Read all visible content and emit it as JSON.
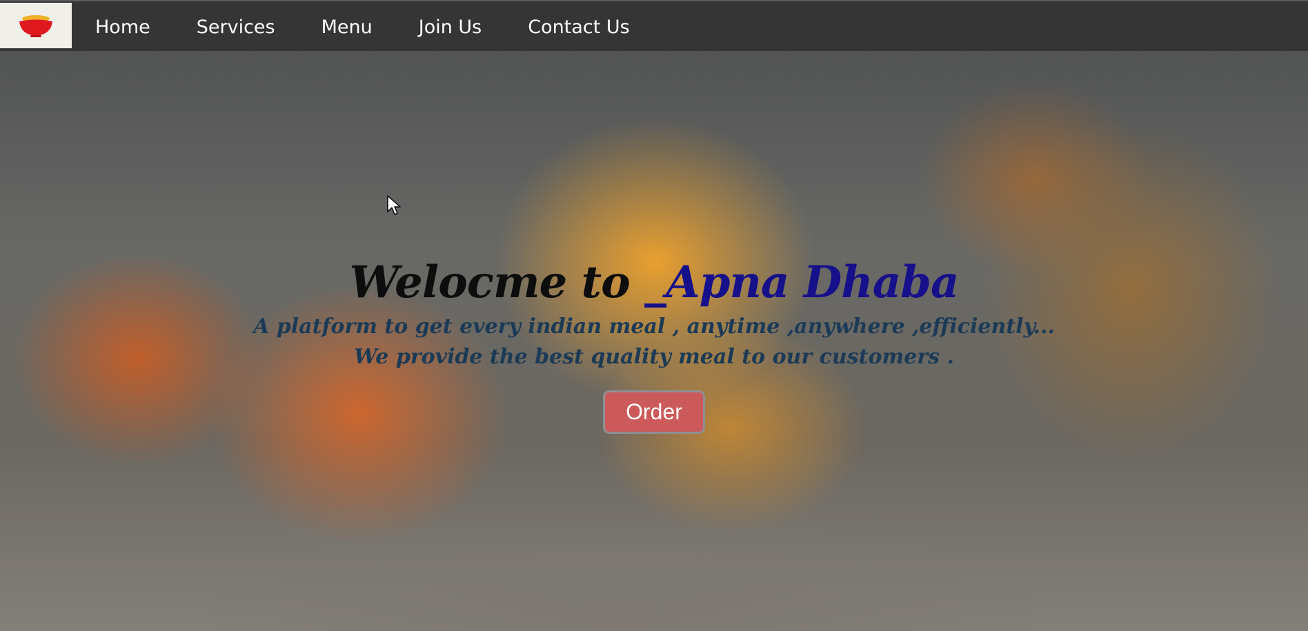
{
  "navbar": {
    "logo_icon": "bowl-icon",
    "items": [
      {
        "label": "Home"
      },
      {
        "label": "Services"
      },
      {
        "label": "Menu"
      },
      {
        "label": "Join Us"
      },
      {
        "label": "Contact Us"
      }
    ]
  },
  "hero": {
    "title_prefix": "Welocme to ",
    "title_brand": "_Apna Dhaba",
    "tagline_line1": "A platform to get every indian meal , anytime ,anywhere ,efficiently...",
    "tagline_line2": "We provide the best quality meal to our customers .",
    "order_label": "Order"
  },
  "colors": {
    "navbar_bg": "#353535",
    "brand_text": "#16108a",
    "tagline_text": "#1c3a55",
    "order_button": "#cc5a5a"
  }
}
